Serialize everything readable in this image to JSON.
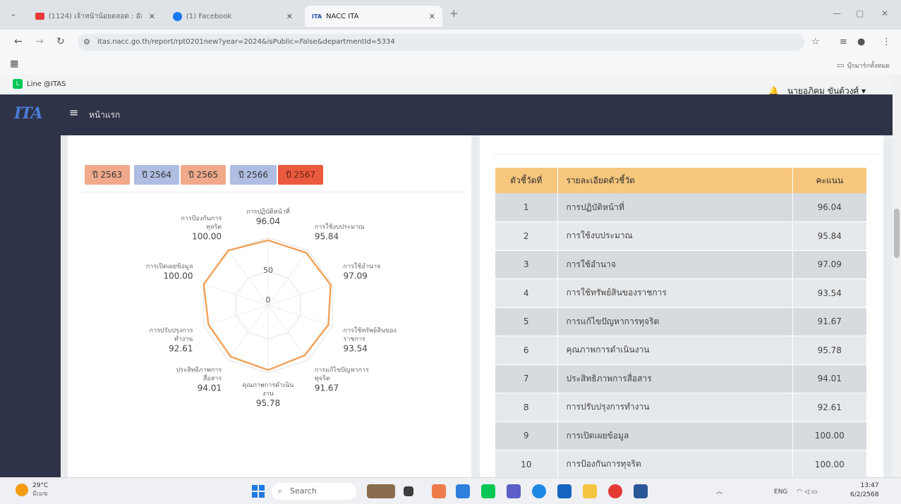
{
  "browser": {
    "tabs": [
      {
        "title": "(1124) เจ้าหน้าน้อยตลอด : อัล...",
        "icon": "youtube-icon",
        "active": false
      },
      {
        "title": "(1) Facebook",
        "icon": "facebook-icon",
        "active": false
      },
      {
        "title": "NACC ITA",
        "icon": "ita-favicon",
        "active": true
      }
    ],
    "url": "itas.nacc.go.th/report/rpt0201new?year=2024&isPublic=False&departmentId=5334",
    "bookmarks_folder": "บุ๊กมาร์กทั้งหมด"
  },
  "page": {
    "line_link": "Line @ITAS",
    "user_name": "นายอภิคม ขันต้วงศ์ ▾",
    "logo": "ITA",
    "home": "หน้าแรก"
  },
  "years": [
    "ปี 2563",
    "ปี 2564",
    "ปี 2565",
    "ปี 2566",
    "ปี 2567"
  ],
  "chart_data": {
    "type": "radar",
    "rmax": 100,
    "ticks": [
      "0",
      "50"
    ],
    "axes": [
      {
        "label1": "การปฏิบัติหน้าที่",
        "label2": "",
        "value": 96.04,
        "value_text": "96.04"
      },
      {
        "label1": "การใช้งบประมาณ",
        "label2": "",
        "value": 95.84,
        "value_text": "95.84"
      },
      {
        "label1": "การใช้อำนาจ",
        "label2": "",
        "value": 97.09,
        "value_text": "97.09"
      },
      {
        "label1": "การใช้ทรัพย์สินของ",
        "label2": "ราชการ",
        "value": 93.54,
        "value_text": "93.54"
      },
      {
        "label1": "การแก้ไขปัญหาการ",
        "label2": "ทุจริต",
        "value": 91.67,
        "value_text": "91.67"
      },
      {
        "label1": "คุณภาพการดำเนิน",
        "label2": "งาน",
        "value": 95.78,
        "value_text": "95.78"
      },
      {
        "label1": "ประสิทธิภาพการ",
        "label2": "สื่อสาร",
        "value": 94.01,
        "value_text": "94.01"
      },
      {
        "label1": "การปรับปรุงการ",
        "label2": "ทำงาน",
        "value": 92.61,
        "value_text": "92.61"
      },
      {
        "label1": "การเปิดเผยข้อมูล",
        "label2": "",
        "value": 100.0,
        "value_text": "100.00"
      },
      {
        "label1": "การป้องกันการ",
        "label2": "ทุจริต",
        "value": 100.0,
        "value_text": "100.00"
      }
    ],
    "line_color": "#f0a35c"
  },
  "table": {
    "headers": [
      "ตัวชี้วัดที่",
      "รายละเอียดตัวชี้วัด",
      "คะแนน"
    ],
    "rows": [
      [
        "1",
        "การปฏิบัติหน้าที่",
        "96.04"
      ],
      [
        "2",
        "การใช้งบประมาณ",
        "95.84"
      ],
      [
        "3",
        "การใช้อำนาจ",
        "97.09"
      ],
      [
        "4",
        "การใช้ทรัพย์สินของราชการ",
        "93.54"
      ],
      [
        "5",
        "การแก้ไขปัญหาการทุจริต",
        "91.67"
      ],
      [
        "6",
        "คุณภาพการดำเนินงาน",
        "95.78"
      ],
      [
        "7",
        "ประสิทธิภาพการสื่อสาร",
        "94.01"
      ],
      [
        "8",
        "การปรับปรุงการทำงาน",
        "92.61"
      ],
      [
        "9",
        "การเปิดเผยข้อมูล",
        "100.00"
      ],
      [
        "10",
        "การป้องกันการทุจริต",
        "100.00"
      ]
    ]
  },
  "taskbar": {
    "weather_temp": "29°C",
    "weather_desc": "มีเมฆ",
    "search": "Search",
    "lang": "ENG",
    "time": "13:47",
    "date": "6/2/2568"
  }
}
